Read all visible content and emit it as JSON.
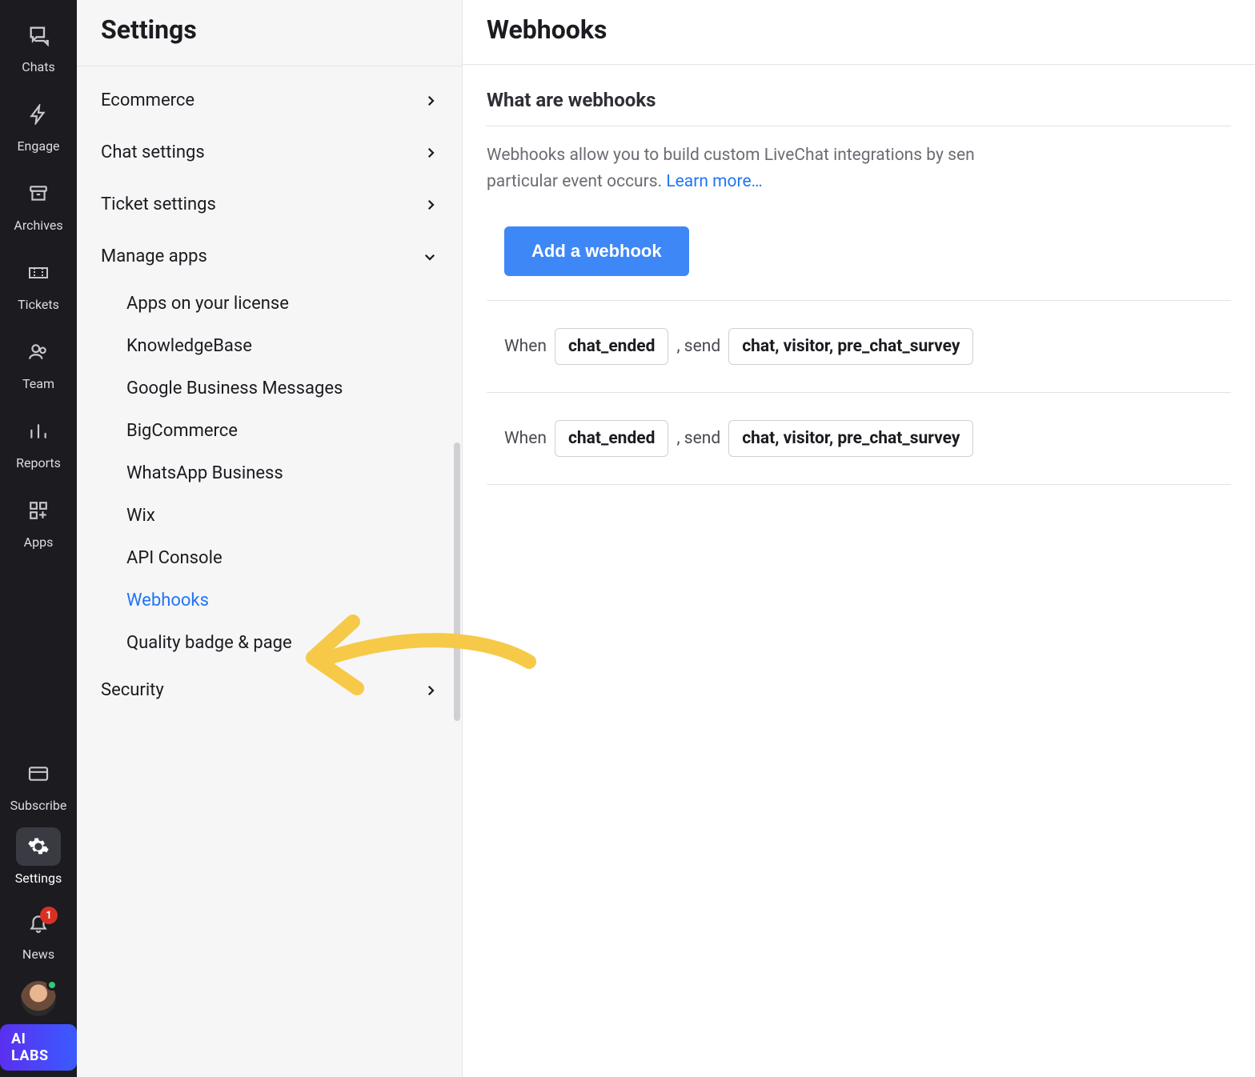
{
  "nav": {
    "items": [
      {
        "label": "Chats"
      },
      {
        "label": "Engage"
      },
      {
        "label": "Archives"
      },
      {
        "label": "Tickets"
      },
      {
        "label": "Team"
      },
      {
        "label": "Reports"
      },
      {
        "label": "Apps"
      }
    ],
    "subscribe_label": "Subscribe",
    "settings_label": "Settings",
    "news_label": "News",
    "news_badge": "1",
    "ai_labs_label": "AI LABS"
  },
  "sidebar": {
    "title": "Settings",
    "sections": {
      "ecommerce": "Ecommerce",
      "chat_settings": "Chat settings",
      "ticket_settings": "Ticket settings",
      "manage_apps": "Manage apps",
      "security": "Security"
    },
    "manage_apps_items": [
      "Apps on your license",
      "KnowledgeBase",
      "Google Business Messages",
      "BigCommerce",
      "WhatsApp Business",
      "Wix",
      "API Console",
      "Webhooks",
      "Quality badge & page"
    ]
  },
  "main": {
    "title": "Webhooks",
    "section_title": "What are webhooks",
    "desc_part1": "Webhooks allow you to build custom LiveChat integrations by sen",
    "desc_part2": "particular event occurs. ",
    "learn_more": "Learn more…",
    "add_button": "Add a webhook",
    "rules": [
      {
        "when_label": "When",
        "event": "chat_ended",
        "send_label": ", send",
        "payload": "chat, visitor, pre_chat_survey"
      },
      {
        "when_label": "When",
        "event": "chat_ended",
        "send_label": ", send",
        "payload": "chat, visitor, pre_chat_survey"
      }
    ]
  }
}
